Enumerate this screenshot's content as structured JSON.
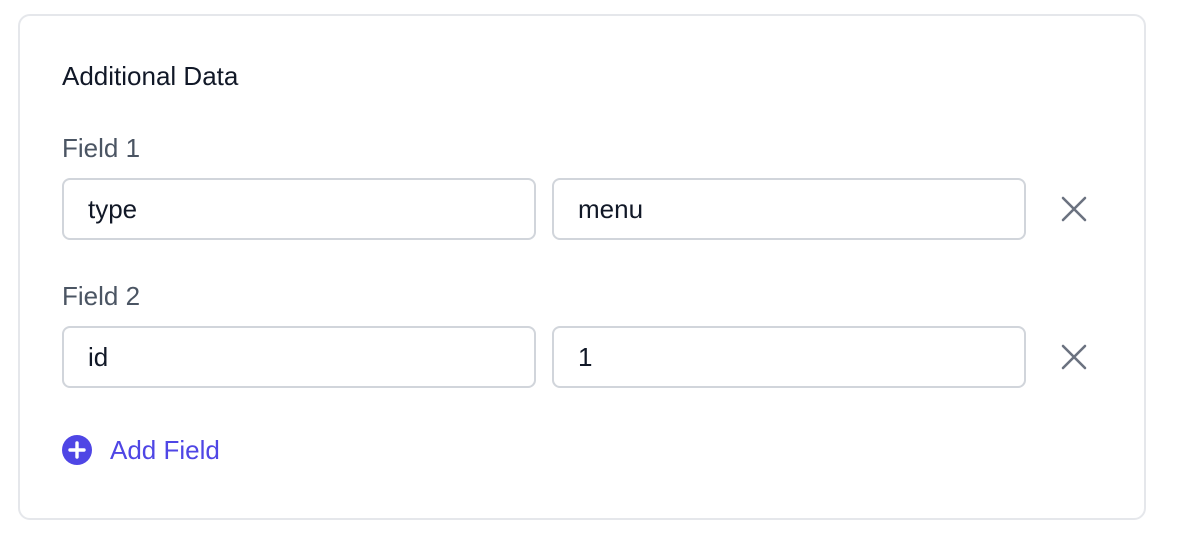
{
  "section": {
    "title": "Additional Data"
  },
  "fields": [
    {
      "label": "Field 1",
      "key": "type",
      "value": "menu"
    },
    {
      "label": "Field 2",
      "key": "id",
      "value": "1"
    }
  ],
  "add_field": {
    "label": "Add Field",
    "icon": "plus-circle-icon"
  },
  "remove_icon": "close-icon",
  "colors": {
    "accent": "#4f46e5",
    "text": "#111827",
    "label": "#4b5563",
    "border": "#d1d5db",
    "card_border": "#e5e7eb",
    "icon_gray": "#6b7280"
  }
}
